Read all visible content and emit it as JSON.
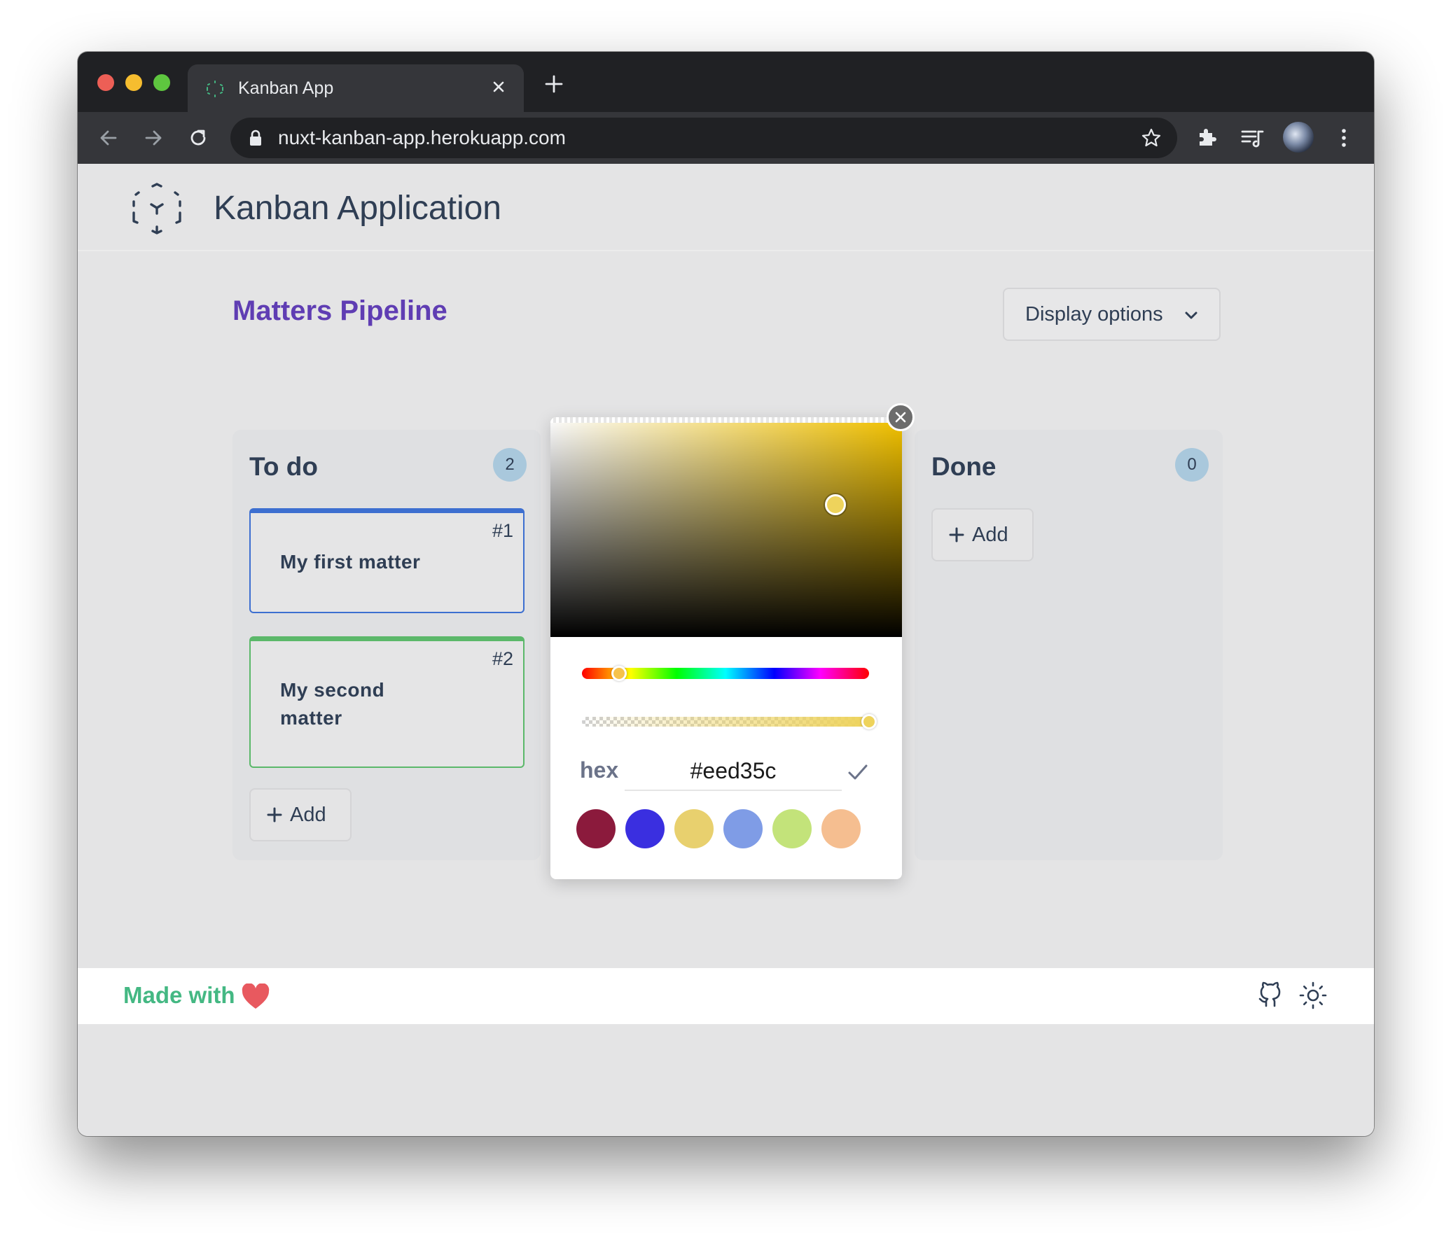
{
  "browser": {
    "tab_title": "Kanban App",
    "url": "nuxt-kanban-app.herokuapp.com"
  },
  "app": {
    "title": "Kanban Application"
  },
  "board": {
    "title": "Matters Pipeline",
    "display_options_label": "Display options"
  },
  "columns": [
    {
      "title": "To do",
      "count": "2",
      "add_label": "Add",
      "cards": [
        {
          "number": "#1",
          "text": "My first matter",
          "accent": "#3d6fd0"
        },
        {
          "number": "#2",
          "text": "My second matter",
          "accent": "#5bb86a"
        }
      ]
    },
    {
      "title": "Done",
      "count": "0",
      "add_label": "Add",
      "cards": []
    }
  ],
  "color_picker": {
    "mode_label": "hex",
    "hex_value": "#eed35c",
    "hue_position": 0.13,
    "alpha": 1.0,
    "swatches": [
      "#8b1a3c",
      "#3a2fe0",
      "#e8d06e",
      "#7f9ce6",
      "#c3e37a",
      "#f5be90"
    ]
  },
  "footer": {
    "made_with": "Made with"
  }
}
